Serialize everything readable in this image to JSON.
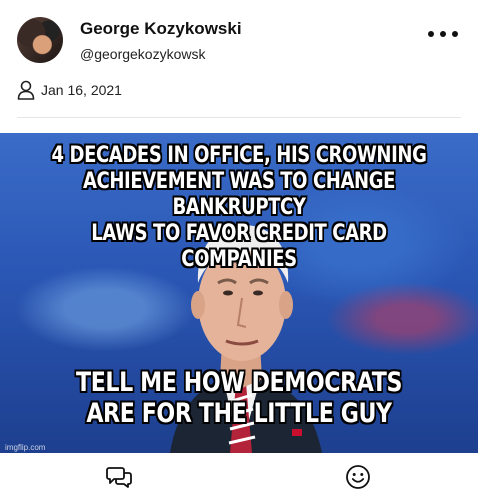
{
  "post": {
    "author_name": "George Kozykowski",
    "author_handle": "@georgekozykowsk",
    "date": "Jan 16, 2021"
  },
  "meme": {
    "top_text_lines": [
      "4 DECADES IN OFFICE, HIS CROWNING",
      "ACHIEVEMENT WAS TO CHANGE BANKRUPTCY",
      "LAWS TO FAVOR CREDIT CARD COMPANIES"
    ],
    "bottom_text_lines": [
      "TELL ME HOW DEMOCRATS",
      "ARE FOR THE LITTLE GUY"
    ],
    "watermark": "imgflip.com"
  },
  "icons": {
    "more": "more-horizontal-icon",
    "date": "person-icon",
    "comment": "comment-bubbles-icon",
    "react": "smiley-face-icon"
  }
}
